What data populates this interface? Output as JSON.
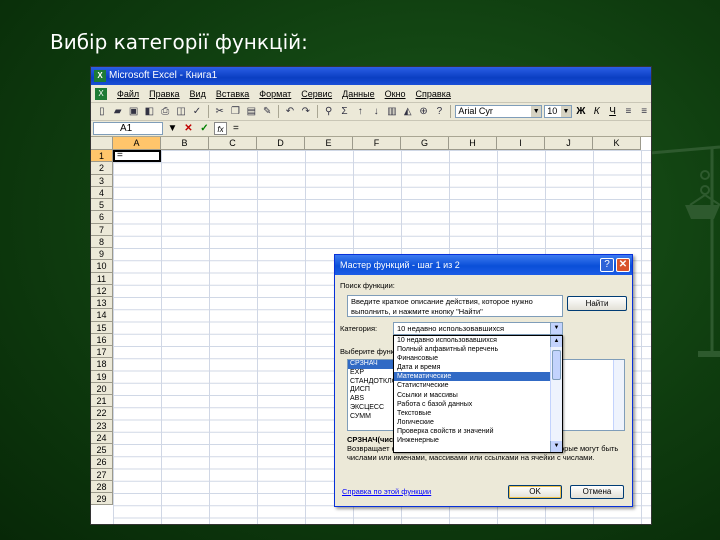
{
  "slide": {
    "title": "Вибір категорії функцій:"
  },
  "excel": {
    "title": "Microsoft Excel - Книга1",
    "menu": [
      "Файл",
      "Правка",
      "Вид",
      "Вставка",
      "Формат",
      "Сервис",
      "Данные",
      "Окно",
      "Справка"
    ],
    "font_name": "Arial Cyr",
    "font_size": "10",
    "bold": "Ж",
    "italic": "К",
    "underline": "Ч",
    "name_box": "A1",
    "formula_text": "=",
    "columns": [
      "A",
      "B",
      "C",
      "D",
      "E",
      "F",
      "G",
      "H",
      "I",
      "J",
      "K"
    ],
    "rows": [
      "1",
      "2",
      "3",
      "4",
      "5",
      "6",
      "7",
      "8",
      "9",
      "10",
      "11",
      "12",
      "13",
      "14",
      "15",
      "16",
      "17",
      "18",
      "19",
      "20",
      "21",
      "22",
      "23",
      "24",
      "25",
      "26",
      "27",
      "28",
      "29"
    ],
    "active_cell_value": "="
  },
  "dialog": {
    "title": "Мастер функций - шаг 1 из 2",
    "search_label": "Поиск функции:",
    "search_placeholder": "Введите краткое описание действия, которое нужно выполнить, и нажмите кнопку \"Найти\"",
    "find_button": "Найти",
    "category_label": "Категория:",
    "category_selected": "10 недавно использовавшихся",
    "categories": [
      "10 недавно использовавшихся",
      "Полный алфавитный перечень",
      "Финансовые",
      "Дата и время",
      "Математические",
      "Статистические",
      "Ссылки и массивы",
      "Работа с базой данных",
      "Текстовые",
      "Логические",
      "Проверка свойств и значений",
      "Инженерные"
    ],
    "highlighted_category": "Математические",
    "function_label": "Выберите функцию:",
    "functions": [
      "СРЗНАЧ",
      "EXP",
      "СТАНДОТКЛОН",
      "ДИСП",
      "ABS",
      "ЭКСЦЕСС",
      "СУММ"
    ],
    "selected_function": "СРЗНАЧ",
    "desc_signature": "СРЗНАЧ(число1;число2;...)",
    "desc_text": "Возвращает среднее арифметическое своих аргументов, которые могут быть числами или именами, массивами или ссылками на ячейки с числами.",
    "help_link": "Справка по этой функции",
    "ok_button": "OK",
    "cancel_button": "Отмена"
  }
}
